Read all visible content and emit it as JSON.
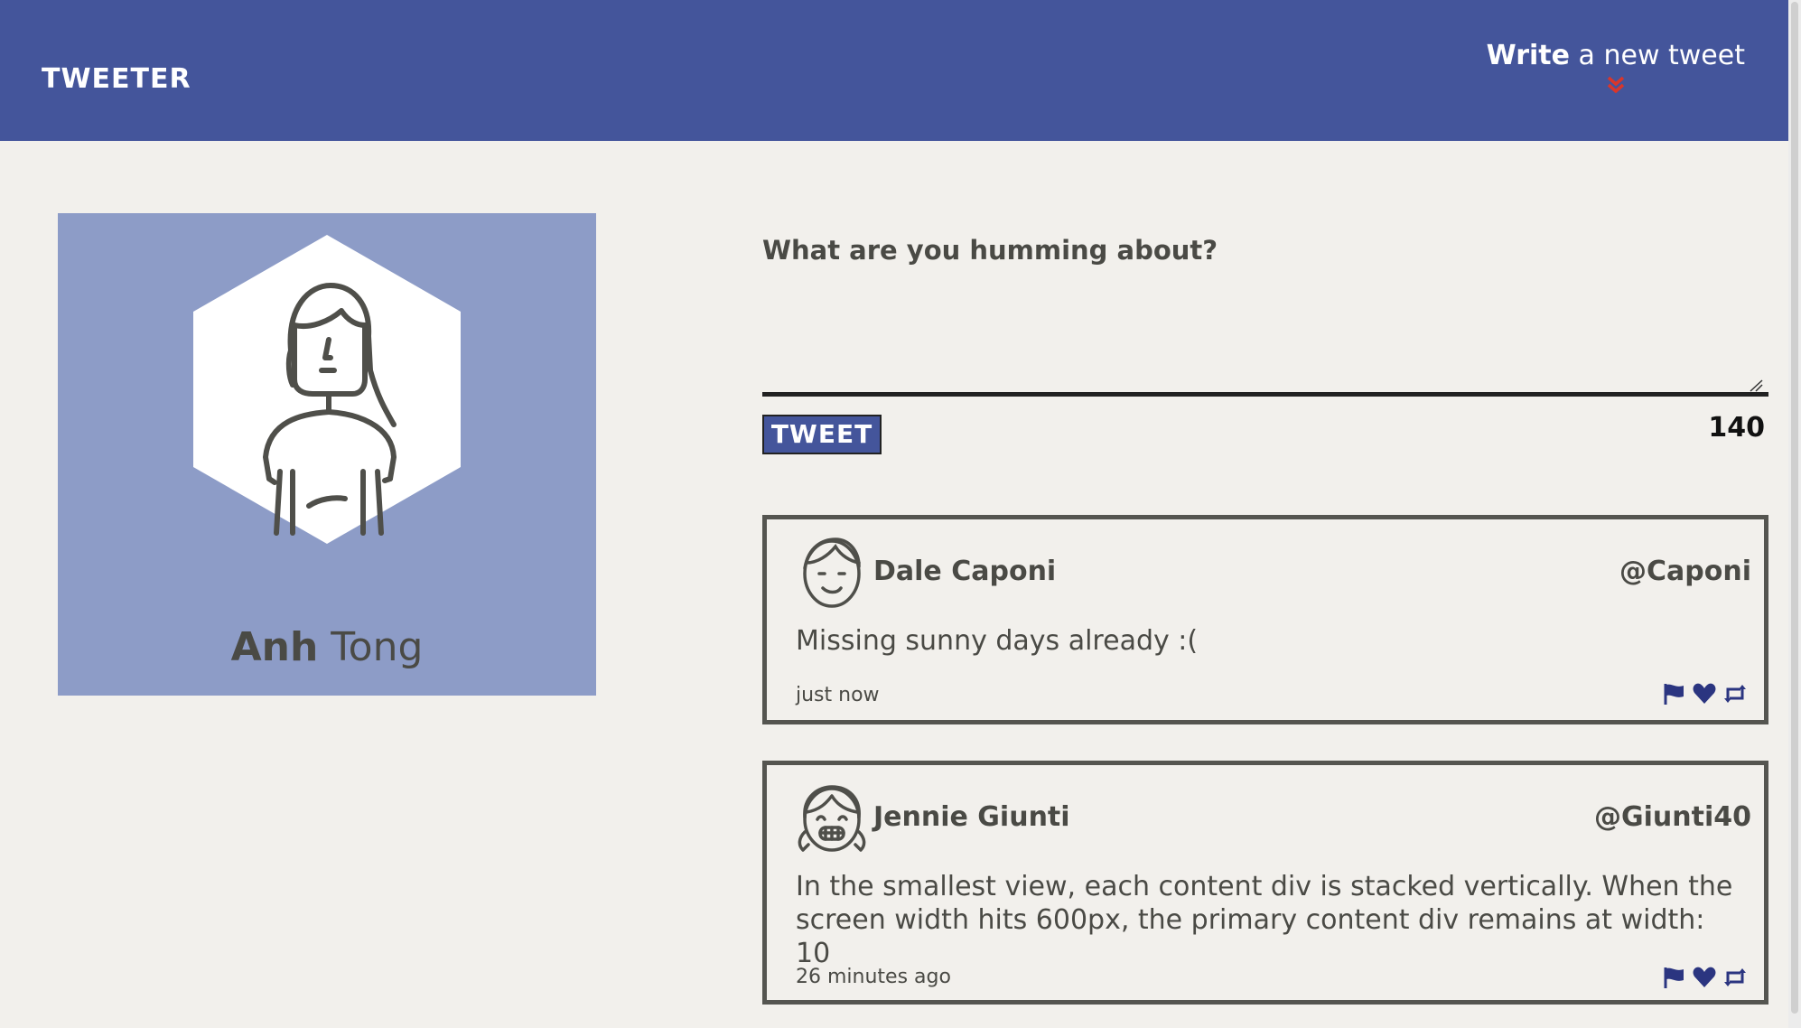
{
  "navbar": {
    "logo": "TWEETER",
    "compose_bold": "Write",
    "compose_rest": "a new tweet",
    "chevron_color": "#d9362b"
  },
  "profile": {
    "first_name": "Anh",
    "last_name": "Tong",
    "avatar_icon": "woman-avatar-icon",
    "panel_color": "#8d9cc7"
  },
  "composer": {
    "heading": "What are you humming about?",
    "textarea_value": "",
    "button_label": "TWEET",
    "char_count": "140"
  },
  "tweets": [
    {
      "author": "Dale Caponi",
      "handle": "@Caponi",
      "content": "Missing sunny days already :(",
      "time": "just now",
      "avatar_icon": "man-avatar-icon"
    },
    {
      "author": "Jennie Giunti",
      "handle": "@Giunti40",
      "content": "In the smallest view, each content div is stacked vertically. When the screen width hits 600px, the primary content div remains at width: 10",
      "time": "26 minutes ago",
      "avatar_icon": "girl-avatar-icon"
    }
  ],
  "colors": {
    "navbar": "#44559b",
    "background": "#f2f0ec",
    "text": "#4a4a45",
    "action_icons": "#2b3580"
  }
}
